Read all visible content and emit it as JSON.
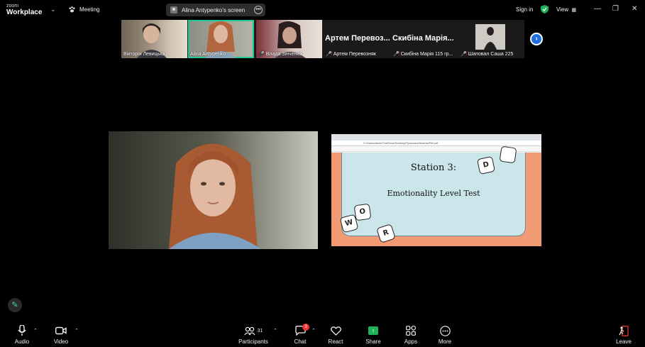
{
  "app": {
    "brand_small": "zoom",
    "brand_big": "Workplace",
    "meeting_label": "Meeting",
    "share_indicator": "Alina Antypenko's screen",
    "signin_label": "Sign in",
    "view_label": "View"
  },
  "thumbnails": [
    {
      "name": "Вікторія Левицька",
      "muted": false,
      "video": true
    },
    {
      "name": "Alina Antypenko",
      "muted": false,
      "video": true,
      "active": true
    },
    {
      "name": "Влада Зінченко",
      "muted": true,
      "video": true
    },
    {
      "name": "Артем Перевозняк",
      "display_name": "Артем Перевоз...",
      "muted": true,
      "video": false
    },
    {
      "name": "Скибіна Марія 115 гр...",
      "display_name": "Скибіна Марія...",
      "muted": true,
      "video": false
    },
    {
      "name": "Шаповал Саша 225",
      "muted": true,
      "video": true
    }
  ],
  "shared_screen": {
    "address_bar": "C:/Users/aknh/OneDrive/Desktop/Практика/Анкета/Pdf.pdf",
    "slide_title": "Station 3:",
    "slide_subtitle": "Emotionality Level Test",
    "tiles": [
      "D",
      "W",
      "O",
      "R"
    ]
  },
  "toolbar": {
    "audio": "Audio",
    "video": "Video",
    "participants": "Participants",
    "participants_count": "31",
    "chat": "Chat",
    "chat_badge": "3",
    "react": "React",
    "share": "Share",
    "apps": "Apps",
    "more": "More",
    "leave": "Leave"
  },
  "colors": {
    "accent_active": "#20c997",
    "share_green": "#1fb25a",
    "next_blue": "#1d6fe0",
    "slide_orange": "#f29a74",
    "slide_blue": "#cbe6ea"
  }
}
